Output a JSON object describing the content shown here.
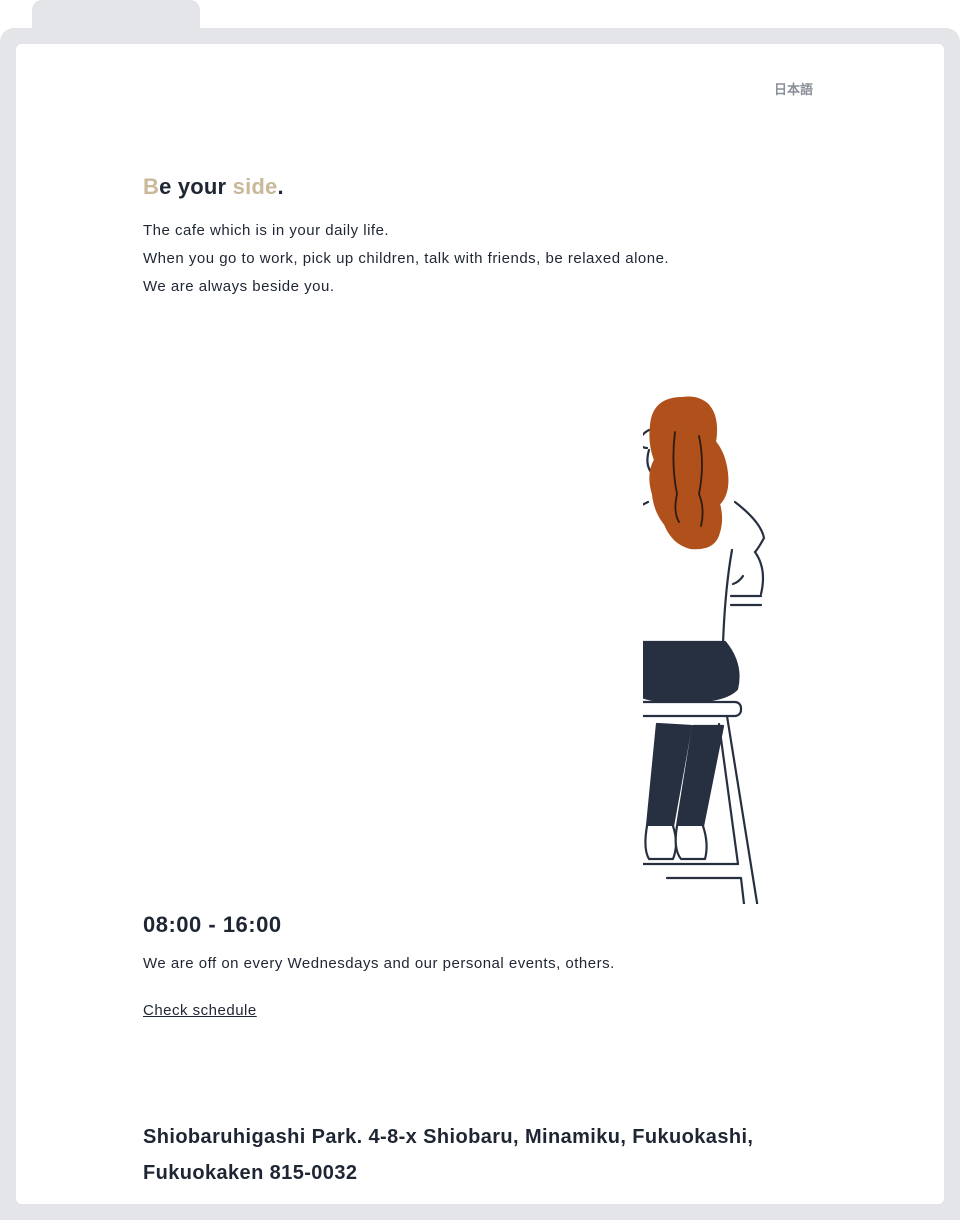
{
  "header": {
    "language_link": "日本語"
  },
  "hero": {
    "headline": {
      "b": "B",
      "e_your": "e your ",
      "side": "side",
      "period": "."
    },
    "intro_lines": [
      "The cafe which is in your daily life.",
      "When you go to work, pick up children, talk with friends, be relaxed alone.",
      "We are always beside you."
    ]
  },
  "hours": {
    "time": "08:00 - 16:00",
    "note": "We are off on every Wednesdays and our personal events, others.",
    "schedule_link": "Check schedule"
  },
  "address": {
    "text": "Shiobaruhigashi Park. 4-8-x Shiobaru, Minamiku, Fukuokashi, Fukuokaken 815-0032"
  },
  "colors": {
    "accent": "#c9b99a",
    "text": "#1f2633",
    "hair": "#b0501a",
    "frame": "#e4e5e8"
  },
  "illustration": {
    "icon": "woman-on-stool-illustration"
  }
}
